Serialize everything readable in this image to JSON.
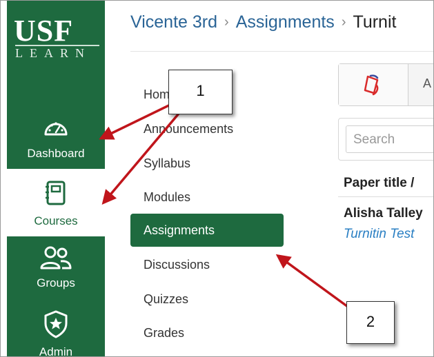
{
  "logo": {
    "primary": "USF",
    "secondary": "LEARN"
  },
  "global_nav": {
    "items": [
      {
        "label": "Dashboard",
        "icon": "dashboard-gauge-icon"
      },
      {
        "label": "Courses",
        "icon": "courses-book-icon",
        "active": true
      },
      {
        "label": "Groups",
        "icon": "groups-people-icon"
      },
      {
        "label": "Admin",
        "icon": "admin-shield-star-icon"
      }
    ]
  },
  "breadcrumb": {
    "items": [
      "Vicente 3rd",
      "Assignments",
      "Turnit"
    ],
    "separator": "›"
  },
  "course_nav": {
    "items": [
      "Home",
      "Announcements",
      "Syllabus",
      "Modules",
      "Assignments",
      "Discussions",
      "Quizzes",
      "Grades"
    ],
    "active": "Assignments"
  },
  "content": {
    "tab_text": "A",
    "tab_icon": "turnitin-logo-icon",
    "search_placeholder": "Search",
    "column_header": "Paper title /",
    "student_name": "Alisha Talley",
    "paper_title": "Turnitin Test"
  },
  "callouts": {
    "one": "1",
    "two": "2"
  },
  "colors": {
    "usf_green": "#1e6a3f",
    "link_blue": "#2a6496",
    "arrow_red": "#c0151b"
  }
}
